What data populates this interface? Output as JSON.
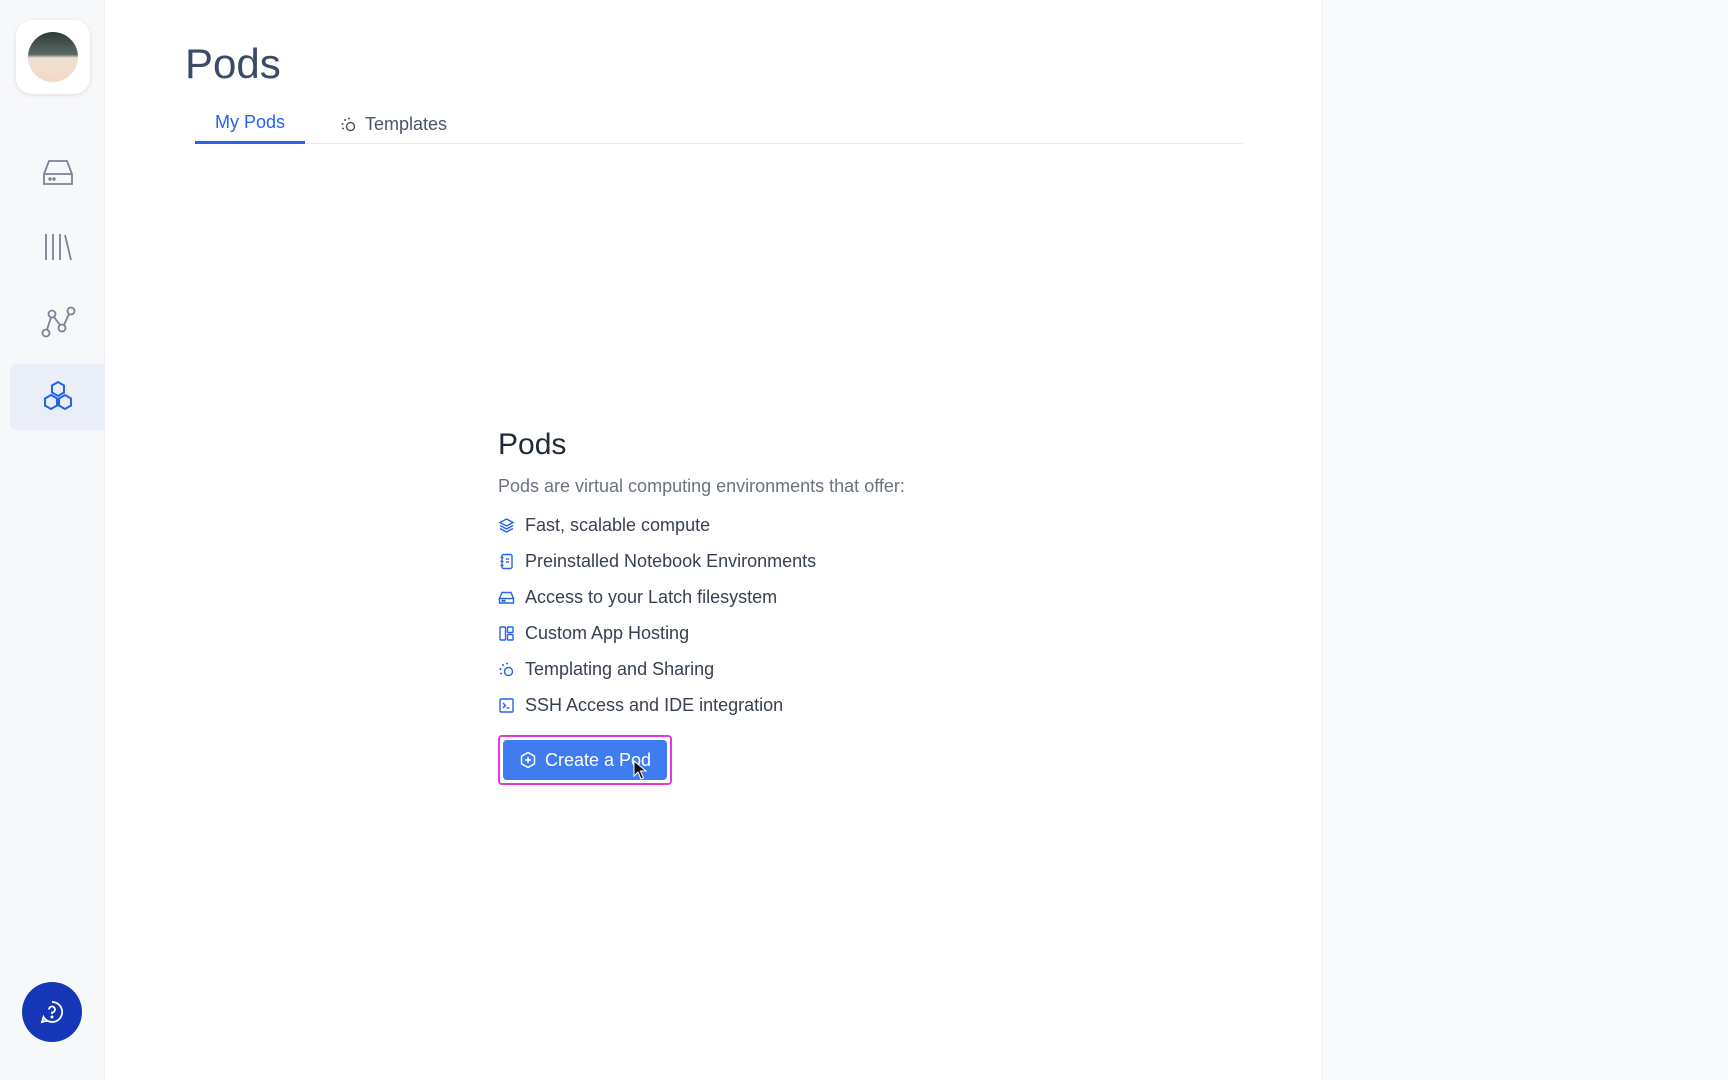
{
  "sidebar": {
    "items": [
      {
        "icon": "drive-icon",
        "active": false
      },
      {
        "icon": "library-icon",
        "active": false
      },
      {
        "icon": "workflow-icon",
        "active": false
      },
      {
        "icon": "pods-icon",
        "active": true
      }
    ],
    "help_icon": "help-chat-icon"
  },
  "header": {
    "title": "Pods"
  },
  "tabs": [
    {
      "label": "My Pods",
      "active": true
    },
    {
      "label": "Templates",
      "active": false,
      "icon": "templates-icon"
    }
  ],
  "empty_state": {
    "title": "Pods",
    "description": "Pods are virtual computing environments that offer:",
    "features": [
      {
        "icon": "layers-icon",
        "label": "Fast, scalable compute"
      },
      {
        "icon": "notebook-icon",
        "label": "Preinstalled Notebook Environments"
      },
      {
        "icon": "drive-icon",
        "label": "Access to your Latch filesystem"
      },
      {
        "icon": "layout-icon",
        "label": "Custom App Hosting"
      },
      {
        "icon": "templates-icon",
        "label": "Templating and Sharing"
      },
      {
        "icon": "terminal-icon",
        "label": "SSH Access and IDE integration"
      }
    ],
    "cta_label": "Create a Pod"
  },
  "colors": {
    "accent": "#2563eb",
    "cta": "#3f7cf0",
    "help": "#1636b8",
    "highlight": "#e53ad7"
  }
}
